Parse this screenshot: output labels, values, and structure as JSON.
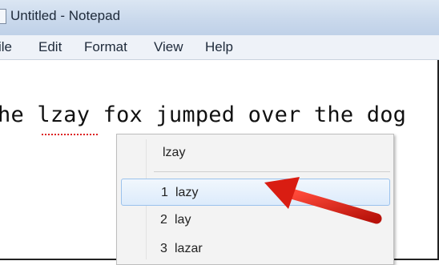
{
  "window": {
    "title": "Untitled - Notepad"
  },
  "menubar": {
    "items": [
      "ile",
      "Edit",
      "Format",
      "View",
      "Help"
    ]
  },
  "editor": {
    "text": "he lzay fox jumped over the dog"
  },
  "context_menu": {
    "header": "lzay",
    "suggestions": [
      {
        "num": "1",
        "word": "lazy"
      },
      {
        "num": "2",
        "word": "lay"
      },
      {
        "num": "3",
        "word": "lazar"
      }
    ],
    "highlighted_index": 0
  },
  "annotation": {
    "arrow_color": "#d91d12"
  }
}
